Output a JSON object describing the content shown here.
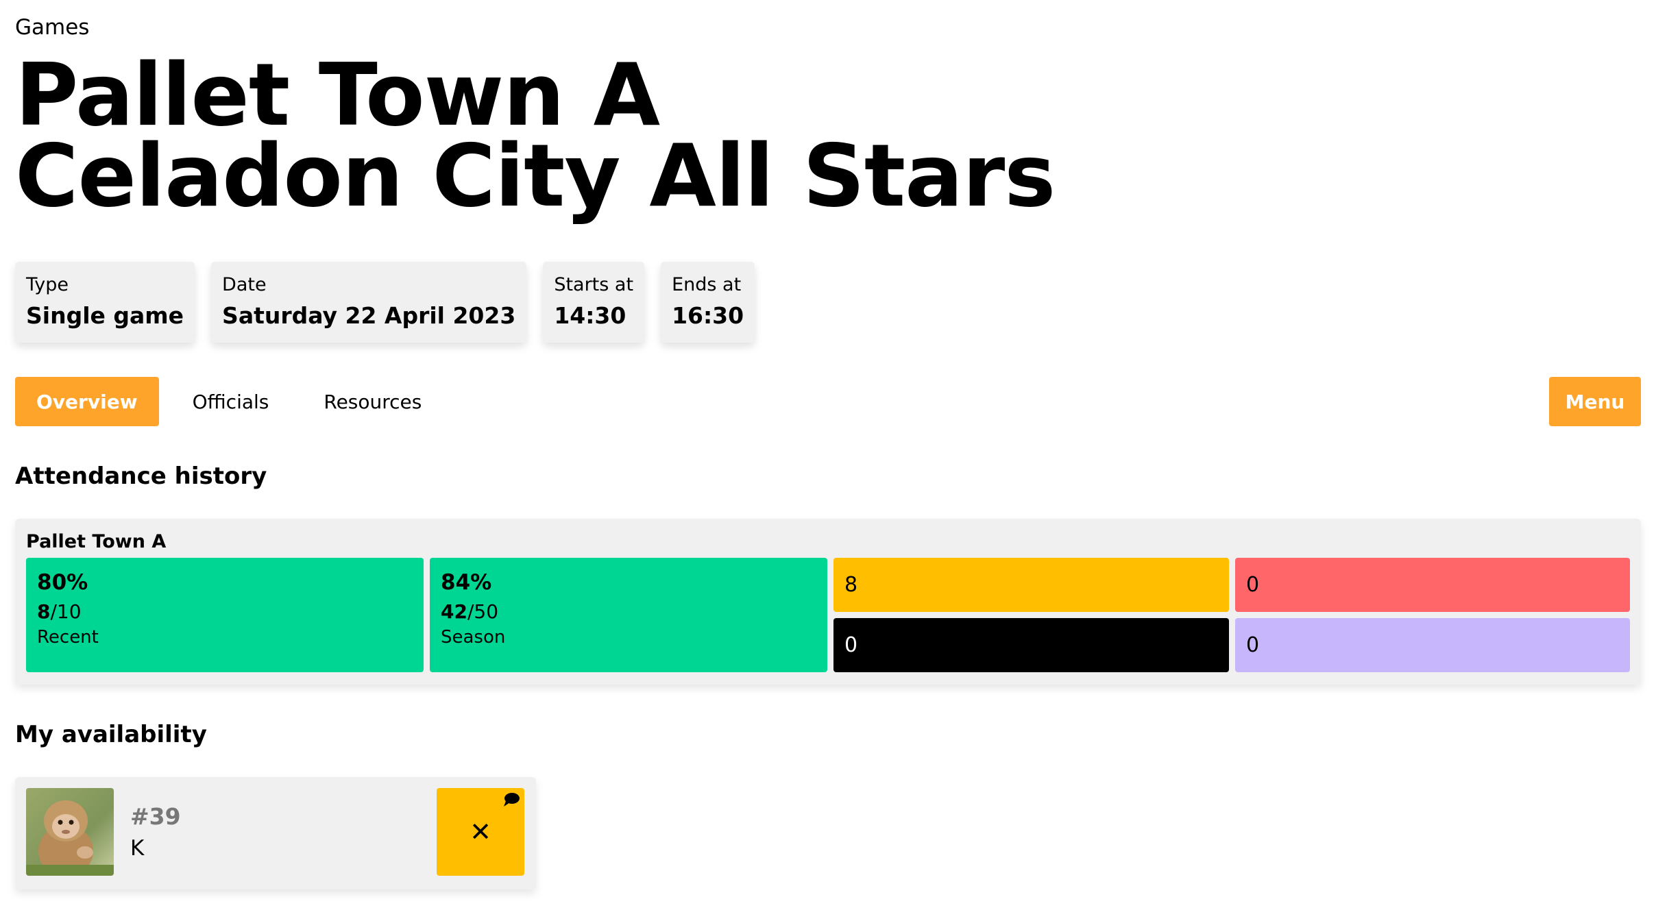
{
  "breadcrumb": "Games",
  "title": {
    "home": "Pallet Town A",
    "away": "Celadon City All Stars"
  },
  "info": [
    {
      "label": "Type",
      "value": "Single game"
    },
    {
      "label": "Date",
      "value": "Saturday 22 April 2023"
    },
    {
      "label": "Starts at",
      "value": "14:30"
    },
    {
      "label": "Ends at",
      "value": "16:30"
    }
  ],
  "tabs": [
    {
      "label": "Overview",
      "active": true
    },
    {
      "label": "Officials",
      "active": false
    },
    {
      "label": "Resources",
      "active": false
    }
  ],
  "menu_label": "Menu",
  "attendance": {
    "heading": "Attendance history",
    "team": "Pallet Town A",
    "recent": {
      "percent": "80%",
      "attended": "8",
      "total": "/10",
      "caption": "Recent"
    },
    "season": {
      "percent": "84%",
      "attended": "42",
      "total": "/50",
      "caption": "Season"
    },
    "counts": {
      "yellow": "8",
      "red": "0",
      "black": "0",
      "purple": "0"
    },
    "colors": {
      "green": "#00d693",
      "yellow": "#ffbf00",
      "red": "#ff6669",
      "black": "#000000",
      "purple": "#c7b6fc"
    }
  },
  "availability": {
    "heading": "My availability",
    "player": {
      "number": "#39",
      "name": "K"
    },
    "status_icon": "close-icon",
    "status_symbol": "✕",
    "status_color": "#ffbf00"
  },
  "accent": "#ffa42b"
}
